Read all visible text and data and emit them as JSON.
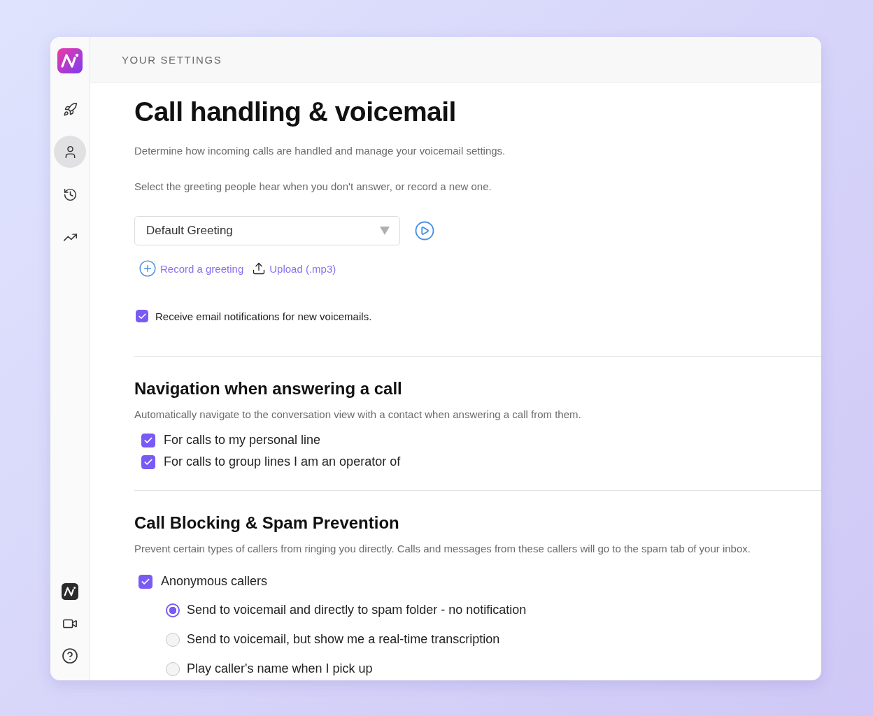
{
  "sidebar": {
    "items": [
      {
        "kind": "rocket",
        "selected": false
      },
      {
        "kind": "person",
        "selected": true
      },
      {
        "kind": "history",
        "selected": false
      },
      {
        "kind": "trend",
        "selected": false
      }
    ],
    "bottom_items": [
      {
        "kind": "logo"
      },
      {
        "kind": "video"
      },
      {
        "kind": "help"
      }
    ]
  },
  "header": {
    "title": "YOUR SETTINGS"
  },
  "page": {
    "title": "Call handling & voicemail",
    "description": "Determine how incoming calls are handled and manage your voicemail settings.",
    "greeting_hint": "Select the greeting people hear when you don't answer, or record a new one.",
    "greeting_select": {
      "value": "Default Greeting"
    },
    "actions": [
      {
        "kind": "record",
        "label": "Record a greeting"
      },
      {
        "kind": "upload",
        "label": "Upload (.mp3)"
      }
    ],
    "email_option": {
      "label": "Receive email notifications for new voicemails.",
      "checked": true
    }
  },
  "sections": [
    {
      "title": "Navigation when answering a call",
      "description": "Automatically navigate to the conversation view with a contact when answering a call from them.",
      "options": [
        {
          "label": "For calls to my personal line",
          "checked": true
        },
        {
          "label": "For calls to group lines I am an operator of",
          "checked": true
        }
      ]
    },
    {
      "title": "Call Blocking & Spam Prevention",
      "description": "Prevent certain types of callers from ringing you directly. Calls and messages from these callers will go to the spam tab of your inbox.",
      "options": [
        {
          "label": "Anonymous callers",
          "checked": true,
          "choices": [
            {
              "label": "Send to voicemail and directly to spam folder - no notification",
              "selected": true
            },
            {
              "label": "Send to voicemail, but show me a real-time transcription",
              "selected": false
            },
            {
              "label": "Play caller's name when I pick up",
              "selected": false
            }
          ]
        }
      ]
    }
  ]
}
